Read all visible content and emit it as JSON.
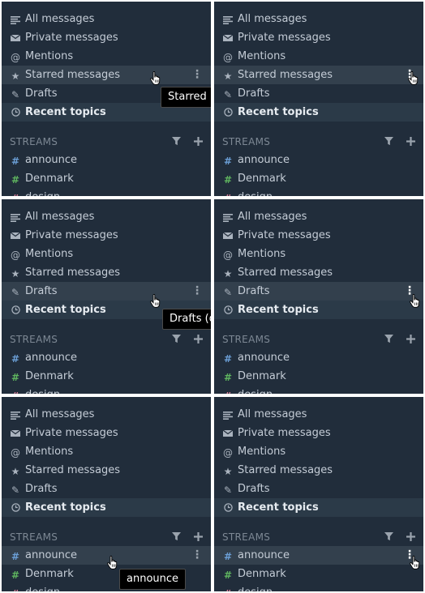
{
  "nav": {
    "all_messages": "All messages",
    "private_messages": "Private messages",
    "mentions": "Mentions",
    "starred_messages": "Starred messages",
    "drafts": "Drafts",
    "recent_topics": "Recent topics"
  },
  "streams": {
    "header": "STREAMS",
    "items": [
      {
        "name": "announce",
        "color": "#6b9fd6"
      },
      {
        "name": "Denmark",
        "color": "#5fb55f"
      },
      {
        "name": "design",
        "color": "#e0829c"
      }
    ]
  },
  "tooltips": {
    "starred": "Starred m",
    "drafts": "Drafts (d",
    "announce": "announce"
  },
  "colors": {
    "sidebar_bg": "#212d3b",
    "hover_bg": "#33404d",
    "recent_bg": "#2b3a48"
  },
  "icons": {
    "all_messages": "align-left-icon",
    "private_messages": "envelope-icon",
    "mentions": "at-icon",
    "starred_messages": "star-icon",
    "drafts": "pencil-icon",
    "recent_topics": "clock-icon",
    "filter": "filter-icon",
    "add": "plus-icon",
    "more": "vertical-ellipsis-icon"
  }
}
